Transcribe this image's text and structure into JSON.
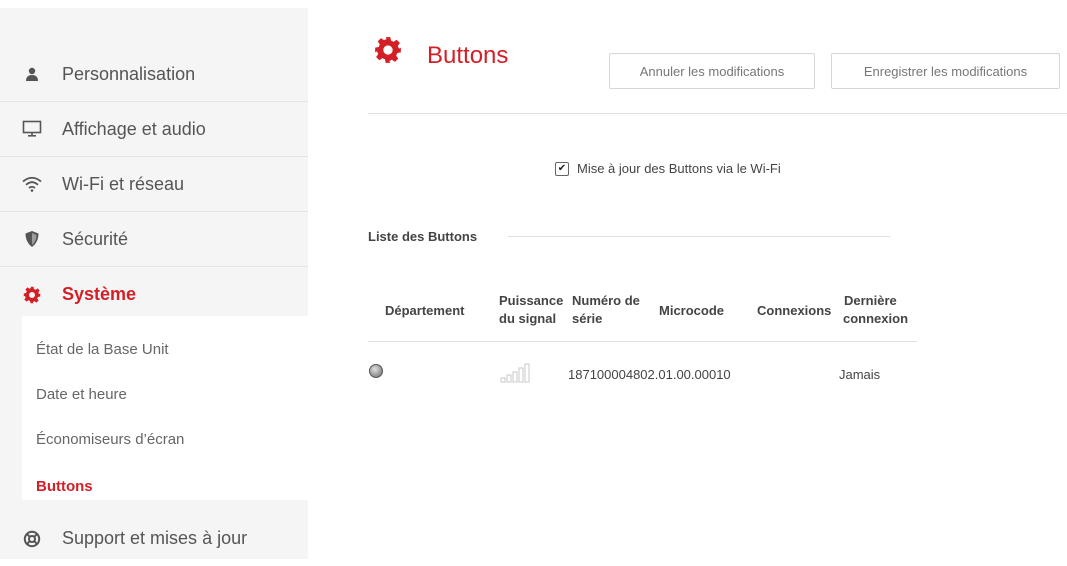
{
  "sidebar": {
    "items": [
      {
        "label": "Personnalisation",
        "icon": "user-icon"
      },
      {
        "label": "Affichage et audio",
        "icon": "monitor-icon"
      },
      {
        "label": "Wi-Fi et réseau",
        "icon": "wifi-icon"
      },
      {
        "label": "Sécurité",
        "icon": "shield-icon"
      },
      {
        "label": "Système",
        "icon": "gear-icon"
      },
      {
        "label": "Support et mises à jour",
        "icon": "lifebuoy-icon"
      }
    ],
    "subitems": [
      {
        "label": "État de la Base Unit"
      },
      {
        "label": "Date et heure"
      },
      {
        "label": "Économiseurs d’écran"
      },
      {
        "label": "Buttons"
      }
    ]
  },
  "header": {
    "title": "Buttons",
    "cancel_label": "Annuler les modifications",
    "save_label": "Enregistrer les modifications"
  },
  "main": {
    "wifi_update_label": "Mise à jour des Buttons via le Wi-Fi",
    "wifi_update_checked": true,
    "list_title": "Liste des Buttons",
    "table": {
      "headers": {
        "department": "Département",
        "signal_1": "Puissance",
        "signal_2": "du signal",
        "serial_1": "Numéro de",
        "serial_2": "série",
        "firmware": "Microcode",
        "connections": "Connexions",
        "last_1": "Dernière",
        "last_2": "connexion"
      },
      "rows": [
        {
          "serial_firmware": "187100004802.01.00.00010",
          "last_connection": "Jamais",
          "signal_bars": 0
        }
      ]
    }
  },
  "colors": {
    "accent": "#d31f26",
    "sidebar_bg": "#f5f5f5"
  }
}
